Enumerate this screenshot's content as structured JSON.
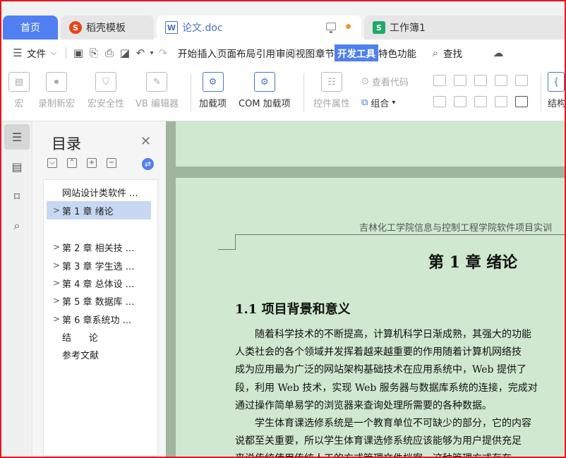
{
  "tabs": {
    "home": "首页",
    "template": "稻壳模板",
    "doc": "论文.doc",
    "sheet": "工作簿1"
  },
  "menu": {
    "file": "文件",
    "items": [
      "开始",
      "插入",
      "页面布局",
      "引用",
      "审阅",
      "视图",
      "章节",
      "开发工具",
      "特色功能"
    ],
    "active": "开发工具",
    "search": "查找"
  },
  "ribbon": {
    "macro": "宏",
    "record_macro": "录制新宏",
    "macro_security": "宏安全性",
    "vb_editor": "VB 编辑器",
    "addins": "加载项",
    "com_addins": "COM 加载项",
    "control_props": "控件属性",
    "view_code": "查看代码",
    "group": "组合",
    "struct": "结构"
  },
  "toc": {
    "title": "目录",
    "items": [
      {
        "label": "网站设计类软件 ...",
        "chevron": ""
      },
      {
        "label": "第 1 章  绪论",
        "chevron": ">"
      },
      {
        "label": "第 2 章  相关技 ...",
        "chevron": ">"
      },
      {
        "label": "第 3 章  学生选 ...",
        "chevron": ">"
      },
      {
        "label": "第 4 章  总体设 ...",
        "chevron": ">"
      },
      {
        "label": "第 5 章  数据库 ...",
        "chevron": ">"
      },
      {
        "label": "第 6 章系统功 ...",
        "chevron": ">"
      },
      {
        "label": "结      论",
        "chevron": ""
      },
      {
        "label": "参考文献",
        "chevron": ""
      }
    ]
  },
  "document": {
    "running_header": "吉林化工学院信息与控制工程学院软件项目实训",
    "chapter_title": "第 1 章  绪论",
    "section_title": "1.1  项目背景和意义",
    "paragraphs": [
      "随着科学技术的不断提高，计算机科学日渐成熟，其强大的功能",
      "人类社会的各个领域并发挥着越来越重要的作用随着计算机网络技",
      "成为应用最为广泛的网站架构基础技术在应用系统中，Web 提供了",
      "段，利用 Web 技术，实现 Web 服务器与数据库系统的连接，完成对",
      "通过操作简单易学的浏览器来查询处理所需要的各种数据。",
      "学生体育课选修系统是一个教育单位不可缺少的部分，它的内容",
      "说都至关重要，所以学生体育课选修系统应该能够为用户提供充足",
      "来说传统使用传统人工的方式管理文件档案，这种管理方式存在"
    ]
  },
  "colors": {
    "accent": "#4f7ff0",
    "page_bg": "#cfe8cf",
    "frame": "#e8141e"
  }
}
